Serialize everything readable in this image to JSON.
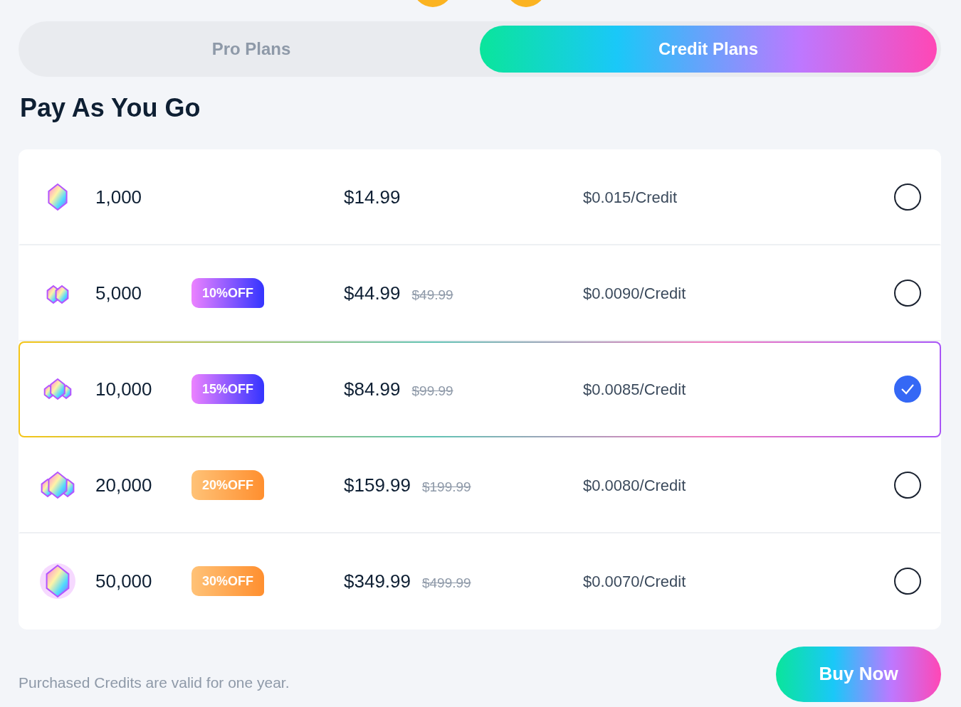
{
  "tabs": [
    {
      "label": "Pro Plans",
      "selected": false
    },
    {
      "label": "Credit Plans",
      "selected": true
    }
  ],
  "heading": "Pay As You Go",
  "plans": [
    {
      "credits": "1,000",
      "price": "$14.99",
      "per_credit": "$0.015/Credit",
      "selected": false
    },
    {
      "credits": "5,000",
      "badge": {
        "text": "10%OFF",
        "kind": "cool"
      },
      "price": "$44.99",
      "old_price": "$49.99",
      "per_credit": "$0.0090/Credit",
      "selected": false
    },
    {
      "credits": "10,000",
      "badge": {
        "text": "15%OFF",
        "kind": "cool"
      },
      "price": "$84.99",
      "old_price": "$99.99",
      "per_credit": "$0.0085/Credit",
      "selected": true
    },
    {
      "credits": "20,000",
      "badge": {
        "text": "20%OFF",
        "kind": "warm"
      },
      "price": "$159.99",
      "old_price": "$199.99",
      "per_credit": "$0.0080/Credit",
      "selected": false
    },
    {
      "credits": "50,000",
      "badge": {
        "text": "30%OFF",
        "kind": "warm"
      },
      "price": "$349.99",
      "old_price": "$499.99",
      "per_credit": "$0.0070/Credit",
      "selected": false
    }
  ],
  "note": "Purchased Credits are valid for one year.",
  "buy_button": "Buy Now"
}
